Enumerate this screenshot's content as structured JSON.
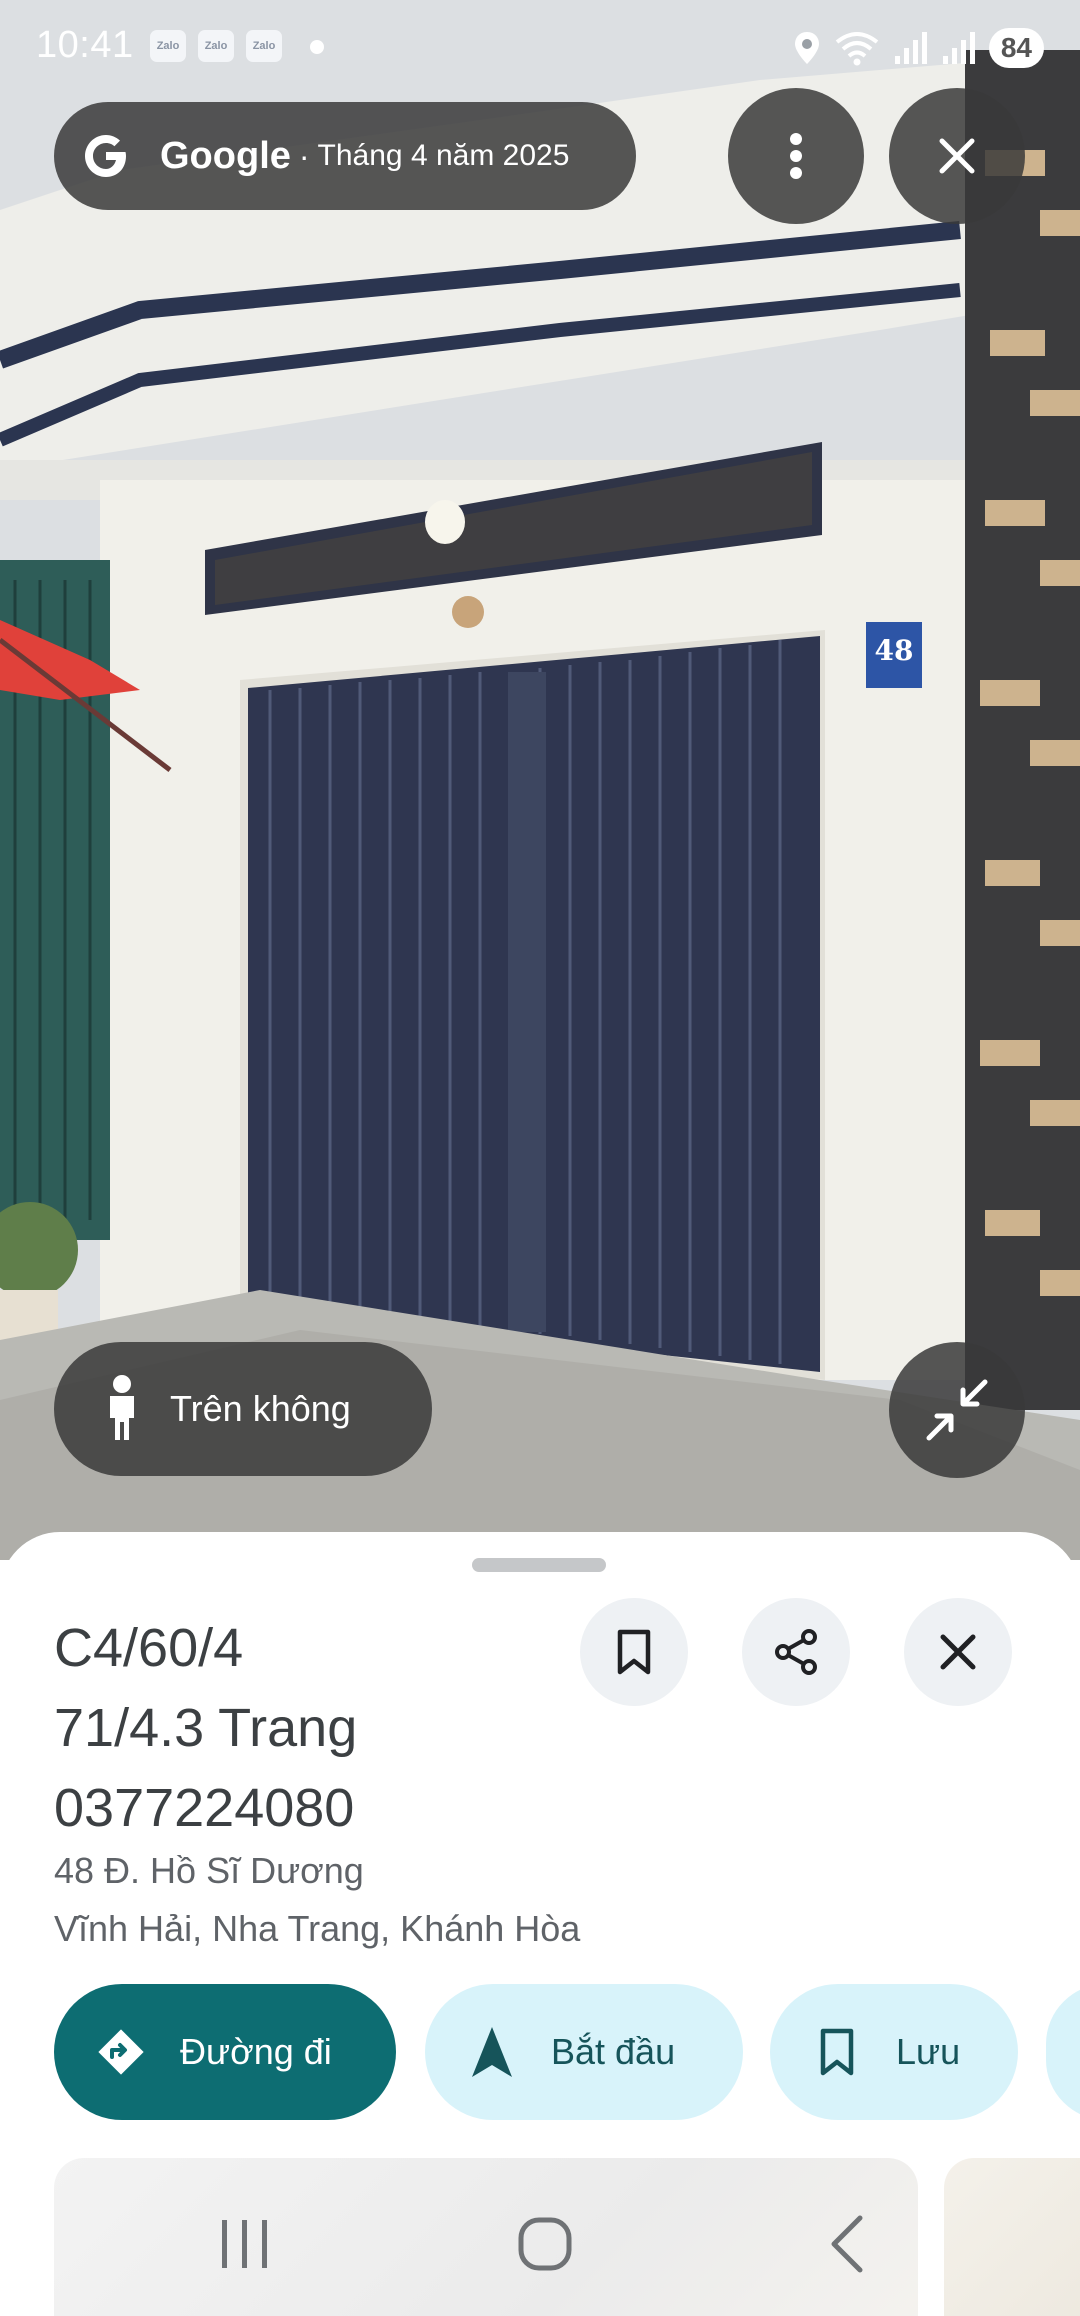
{
  "status_bar": {
    "time": "10:41",
    "notification_apps": [
      "Zalo",
      "Zalo",
      "Zalo"
    ],
    "battery": "84"
  },
  "street_view": {
    "provider": "Google",
    "separator": "·",
    "capture_date": "Tháng 4 năm 2025",
    "mode_label": "Trên không",
    "house_number_sign": "48"
  },
  "place": {
    "title_lines": [
      "C4/60/4",
      "71/4.3 Trang",
      "0377224080"
    ],
    "address_line1": "48 Đ. Hồ Sĩ Dương",
    "address_line2": "Vĩnh Hải, Nha Trang, Khánh Hòa"
  },
  "actions": {
    "directions_label": "Đường đi",
    "start_label": "Bắt đầu",
    "save_label": "Lưu"
  },
  "colors": {
    "primary_teal": "#0d6d72",
    "chip_light": "#d8f3fa",
    "overlay_dark": "#3a3a3a"
  },
  "icons": {
    "more": "more-vert-icon",
    "close": "close-icon",
    "pegman": "pegman-icon",
    "collapse": "collapse-icon",
    "bookmark": "bookmark-icon",
    "share": "share-icon",
    "directions": "directions-icon",
    "navigation": "navigation-arrow-icon"
  }
}
